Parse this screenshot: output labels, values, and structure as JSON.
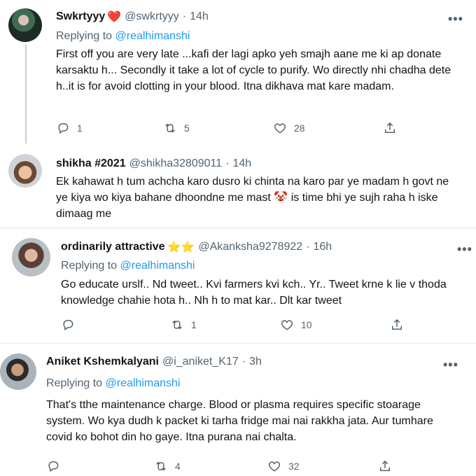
{
  "tweets": [
    {
      "name": "Swkrtyyy",
      "name_emoji": "❤️",
      "handle": "@swkrtyyy",
      "time": "14h",
      "replying_label": "Replying to",
      "replying_to": "@realhimanshi",
      "text": "First off you are very late ...kafi der lagi apko yeh smajh aane me ki ap donate karsaktu h... Secondly it take a lot of cycle to purify. Wo directly nhi chadha dete h..it is for avoid clotting in your blood. Itna dikhava mat kare madam.",
      "replies": "1",
      "retweets": "5",
      "likes": "28"
    },
    {
      "name": "shikha #2021",
      "handle": "@shikha32809011",
      "time": "14h",
      "text_before": "Ek kahawat h tum achcha karo dusro ki chinta na karo par ye madam h govt ne ye kiya wo kiya bahane dhoondne me mast",
      "text_emoji": "🤡",
      "text_after": "is time bhi ye sujh raha h iske dimaag me"
    },
    {
      "name": "ordinarily attractive",
      "name_emoji": "⭐⭐",
      "handle": "@Akanksha9278922",
      "time": "16h",
      "replying_label": "Replying to",
      "replying_to": "@realhimanshi",
      "text": "Go educate urslf.. Nd tweet.. Kvi farmers kvi kch.. Yr.. Tweet krne k lie v thoda knowledge chahie hota h.. Nh h to mat kar.. Dlt kar tweet",
      "replies": "",
      "retweets": "1",
      "likes": "10"
    },
    {
      "name": "Aniket Kshemkalyani",
      "handle": "@i_aniket_K17",
      "time": "3h",
      "replying_label": "Replying to",
      "replying_to": "@realhimanshi",
      "text": "That's tthe maintenance charge. Blood or plasma requires specific stoarage system. Wo kya dudh k packet ki tarha fridge mai nai rakkha jata. Aur tumhare covid ko bohot din ho gaye. Itna purana nai chalta.",
      "replies": "",
      "retweets": "4",
      "likes": "32"
    }
  ],
  "separator": "·",
  "more_glyph": "•••",
  "colors": {
    "link": "#1d9bf0",
    "secondary": "#536471",
    "heart": "#e0245e"
  },
  "icons": [
    "reply-icon",
    "retweet-icon",
    "like-icon",
    "share-icon",
    "more-icon"
  ]
}
